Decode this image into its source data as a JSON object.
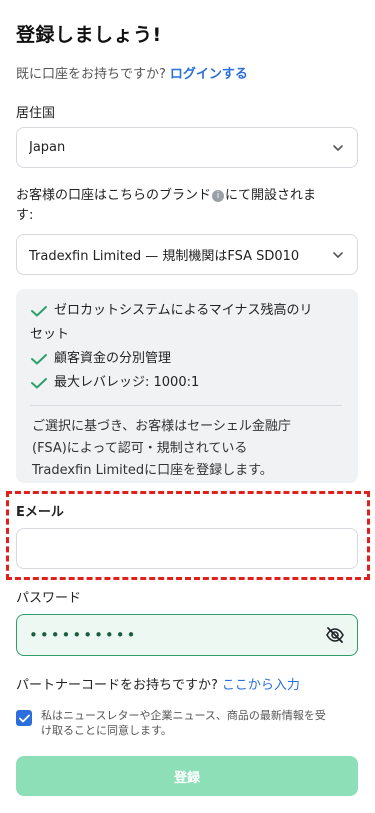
{
  "header": {
    "title": "登録しましょう!"
  },
  "login": {
    "prompt": "既に口座をお持ちですか?",
    "link": "ログインする"
  },
  "residence": {
    "label": "居住国",
    "value": "Japan"
  },
  "brand": {
    "label_part1": "お客様の口座はこちらのブランド",
    "label_part2": "にて開設されま",
    "label_line2": "す:",
    "info_glyph": "i",
    "value": "Tradexfin Limited — 規制機関はFSA SD010"
  },
  "features": {
    "items": [
      {
        "line1": "ゼロカットシステムによるマイナス残高のリ",
        "line2": "セット"
      },
      {
        "line1": "顧客資金の分別管理",
        "line2": ""
      },
      {
        "line1": "最大レバレッジ: 1000:1",
        "line2": ""
      }
    ],
    "note_lines": [
      "ご選択に基づき、お客様はセーシェル金融庁",
      "(FSA)によって認可・規制されている",
      "Tradexfin Limitedに口座を登録します。"
    ]
  },
  "email": {
    "label": "Eメール",
    "value": ""
  },
  "password": {
    "label": "パスワード",
    "masked": "••••••••••"
  },
  "partner": {
    "prompt": "パートナーコードをお持ちですか?",
    "link": "ここから入力"
  },
  "consent": {
    "checked": true,
    "line1": "私はニュースレターや企業ニュース、商品の最新情報を受",
    "line2": "け取ることに同意します。"
  },
  "submit": {
    "label": "登録"
  },
  "colors": {
    "accent": "#2a6fdb",
    "check_green": "#2f9e6c",
    "submit_bg": "#8ddfb8",
    "highlight_red": "#e0201c"
  }
}
